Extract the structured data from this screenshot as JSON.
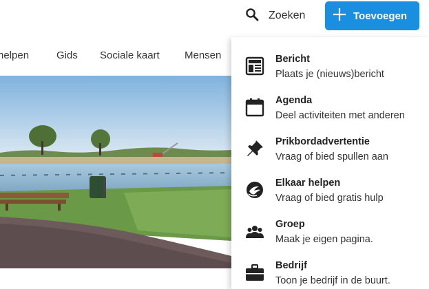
{
  "header": {
    "search_label": "Zoeken",
    "add_label": "Toevoegen",
    "accent": "#1a8fe0"
  },
  "nav": {
    "items": [
      {
        "label": "helpen"
      },
      {
        "label": "Gids"
      },
      {
        "label": "Sociale kaart"
      },
      {
        "label": "Mensen"
      }
    ]
  },
  "add_menu": {
    "items": [
      {
        "title": "Bericht",
        "description": "Plaats je (nieuws)bericht",
        "icon": "newspaper-icon"
      },
      {
        "title": "Agenda",
        "description": "Deel activiteiten met anderen",
        "icon": "calendar-icon"
      },
      {
        "title": "Prikbordadvertentie",
        "description": "Vraag of bied spullen aan",
        "icon": "pushpin-icon"
      },
      {
        "title": "Elkaar helpen",
        "description": "Vraag of bied gratis hulp",
        "icon": "helping-hand-icon"
      },
      {
        "title": "Groep",
        "description": "Maak je eigen pagina.",
        "icon": "group-icon"
      },
      {
        "title": "Bedrijf",
        "description": "Toon je bedrijf in de buurt.",
        "icon": "briefcase-icon"
      }
    ]
  }
}
